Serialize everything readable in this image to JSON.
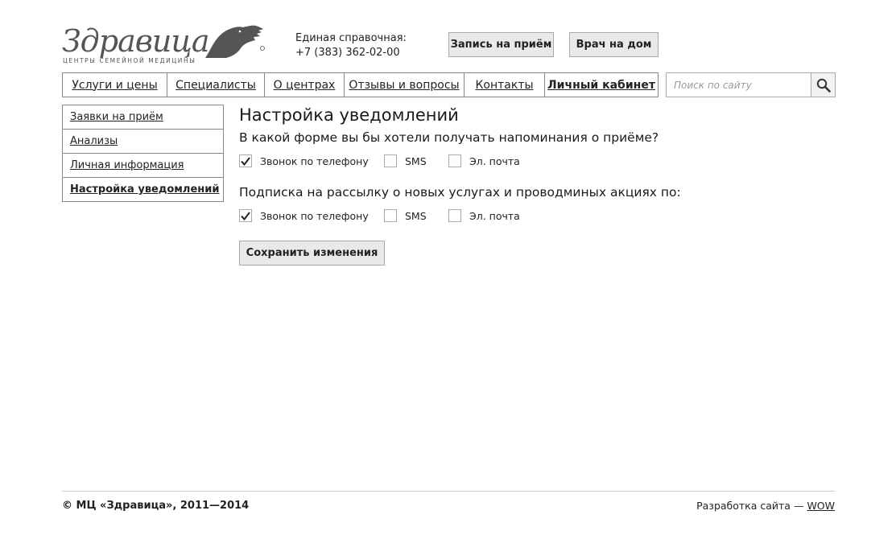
{
  "header": {
    "logo_text": "Здравица",
    "logo_subtitle": "центры семейной медицины",
    "contact_label": "Единая справочная:",
    "contact_phone": "+7 (383) 362-02-00",
    "appointment_button": "Запись на приём",
    "doctor_home_button": "Врач на дом"
  },
  "nav": {
    "items": [
      {
        "label": "Услуги и цены"
      },
      {
        "label": "Специалисты"
      },
      {
        "label": "О центрах"
      },
      {
        "label": "Отзывы и вопросы"
      },
      {
        "label": "Контакты"
      },
      {
        "label": "Личный кабинет",
        "active": true
      }
    ]
  },
  "search": {
    "placeholder": "Поиск по сайту",
    "icon": "search-icon"
  },
  "sidebar": {
    "items": [
      {
        "label": "Заявки на приём"
      },
      {
        "label": "Анализы"
      },
      {
        "label": "Личная информация"
      },
      {
        "label": "Настройка уведомлений",
        "active": true
      }
    ]
  },
  "main": {
    "title": "Настройка уведомлений",
    "reminder": {
      "question": "В какой форме вы бы хотели получать напоминания о приёме?",
      "options": [
        {
          "label": "Звонок по телефону",
          "checked": true
        },
        {
          "label": "SMS",
          "checked": false
        },
        {
          "label": "Эл. почта",
          "checked": false
        }
      ]
    },
    "subscription": {
      "question": "Подписка на рассылку о новых услугах и проводминых акциях по:",
      "options": [
        {
          "label": "Звонок по телефону",
          "checked": true
        },
        {
          "label": "SMS",
          "checked": false
        },
        {
          "label": "Эл. почта",
          "checked": false
        }
      ]
    },
    "save_button": "Сохранить изменения"
  },
  "footer": {
    "copyright": "© МЦ «Здравица», 2011—2014",
    "dev_label": "Разработка сайта —",
    "dev_link": "WOW"
  },
  "colors": {
    "button_bg": "#e9e9e9",
    "border": "#888888",
    "text": "#1a1a1a"
  }
}
